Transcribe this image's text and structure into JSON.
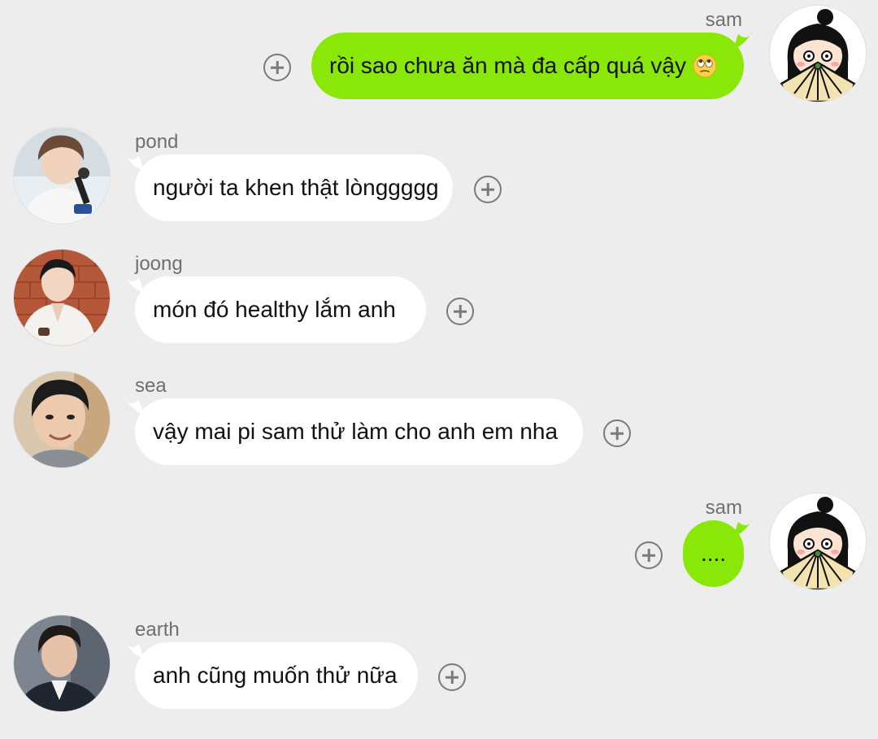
{
  "messages": [
    {
      "sender": "sam",
      "text": "rồi sao chưa ăn mà đa cấp quá vậy",
      "emoji": "face-with-rolling-eyes-icon",
      "direction": "outgoing"
    },
    {
      "sender": "pond",
      "text": "người ta khen thật lònggggg",
      "direction": "incoming"
    },
    {
      "sender": "joong",
      "text": "món đó healthy lắm anh",
      "direction": "incoming"
    },
    {
      "sender": "sea",
      "text": "vậy mai pi sam thử làm cho anh em nha",
      "direction": "incoming"
    },
    {
      "sender": "sam",
      "text": "....",
      "direction": "outgoing"
    },
    {
      "sender": "earth",
      "text": "anh cũng muốn thử nữa",
      "direction": "incoming"
    }
  ],
  "colors": {
    "background": "#ededed",
    "outgoing_bubble": "#8ae808",
    "incoming_bubble": "#ffffff",
    "sender_name": "#6f6f6f",
    "add_reaction_icon": "#7a7a7a"
  },
  "icons": {
    "add_reaction": "plus-circle-icon"
  }
}
